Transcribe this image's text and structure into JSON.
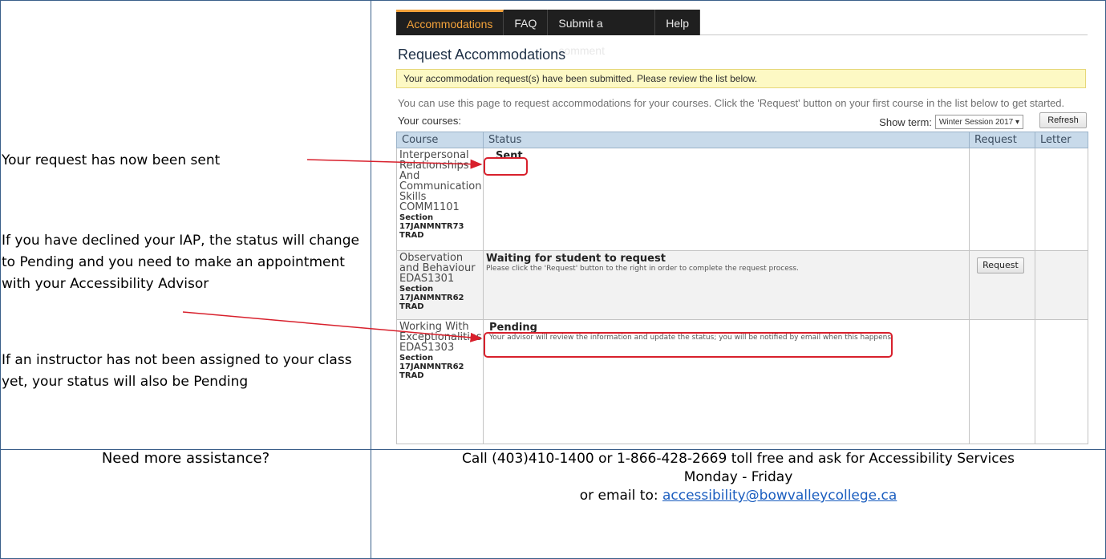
{
  "left_notes": {
    "sent": "Your request has now been sent",
    "declined": "If you have declined your IAP, the status will change to Pending and you need to make an appointment with your Accessibility Advisor",
    "instructor": "If an instructor has not been assigned to your class yet, your status will also be Pending"
  },
  "nav": {
    "tabs": [
      {
        "label": "Accommodations",
        "active": true
      },
      {
        "label": "FAQ"
      },
      {
        "label": "Submit a comment"
      },
      {
        "label": "Help"
      }
    ]
  },
  "page": {
    "title": "Request Accommodations",
    "notice": "Your accommodation request(s) have been submitted. Please review the list below.",
    "intro": "You can use this page to request accommodations for your courses. Click the 'Request' button on your first course in the list below to get started.",
    "your_courses": "Your courses:",
    "show_term_label": "Show term:",
    "term_value": "Winter Session 2017 ▾",
    "refresh": "Refresh"
  },
  "table": {
    "headers": [
      "Course",
      "Status",
      "Request",
      "Letter"
    ],
    "rows": [
      {
        "course": "Interpersonal Relationships And Communication Skills COMM1101",
        "section": "Section 17JANMNTR73 TRAD",
        "status": "Sent",
        "status_note": "",
        "request": ""
      },
      {
        "course": "Observation and Behaviour EDAS1301",
        "section": "Section 17JANMNTR62 TRAD",
        "status": "Waiting for student to request",
        "status_note": "Please click the 'Request' button to the right in order to complete the request process.",
        "request": "Request"
      },
      {
        "course": "Working With Exceptionalities EDAS1303",
        "section": "Section 17JANMNTR62 TRAD",
        "status": "Pending",
        "status_note": "Your advisor will review the information and update the status; you will be notified by email when this happens.",
        "request": ""
      }
    ]
  },
  "help": {
    "question": "Need more assistance?",
    "line1": "Call (403)410-1400 or 1-866-428-2669 toll free and ask for Accessibility Services",
    "line2": "Monday - Friday",
    "email_prefix": "or email to: ",
    "email": "accessibility@bowvalleycollege.ca"
  },
  "colors": {
    "accent_tab": "#f3a23a",
    "highlight": "#d8202c",
    "border": "#3a5f8a",
    "link": "#1a5dbf"
  }
}
